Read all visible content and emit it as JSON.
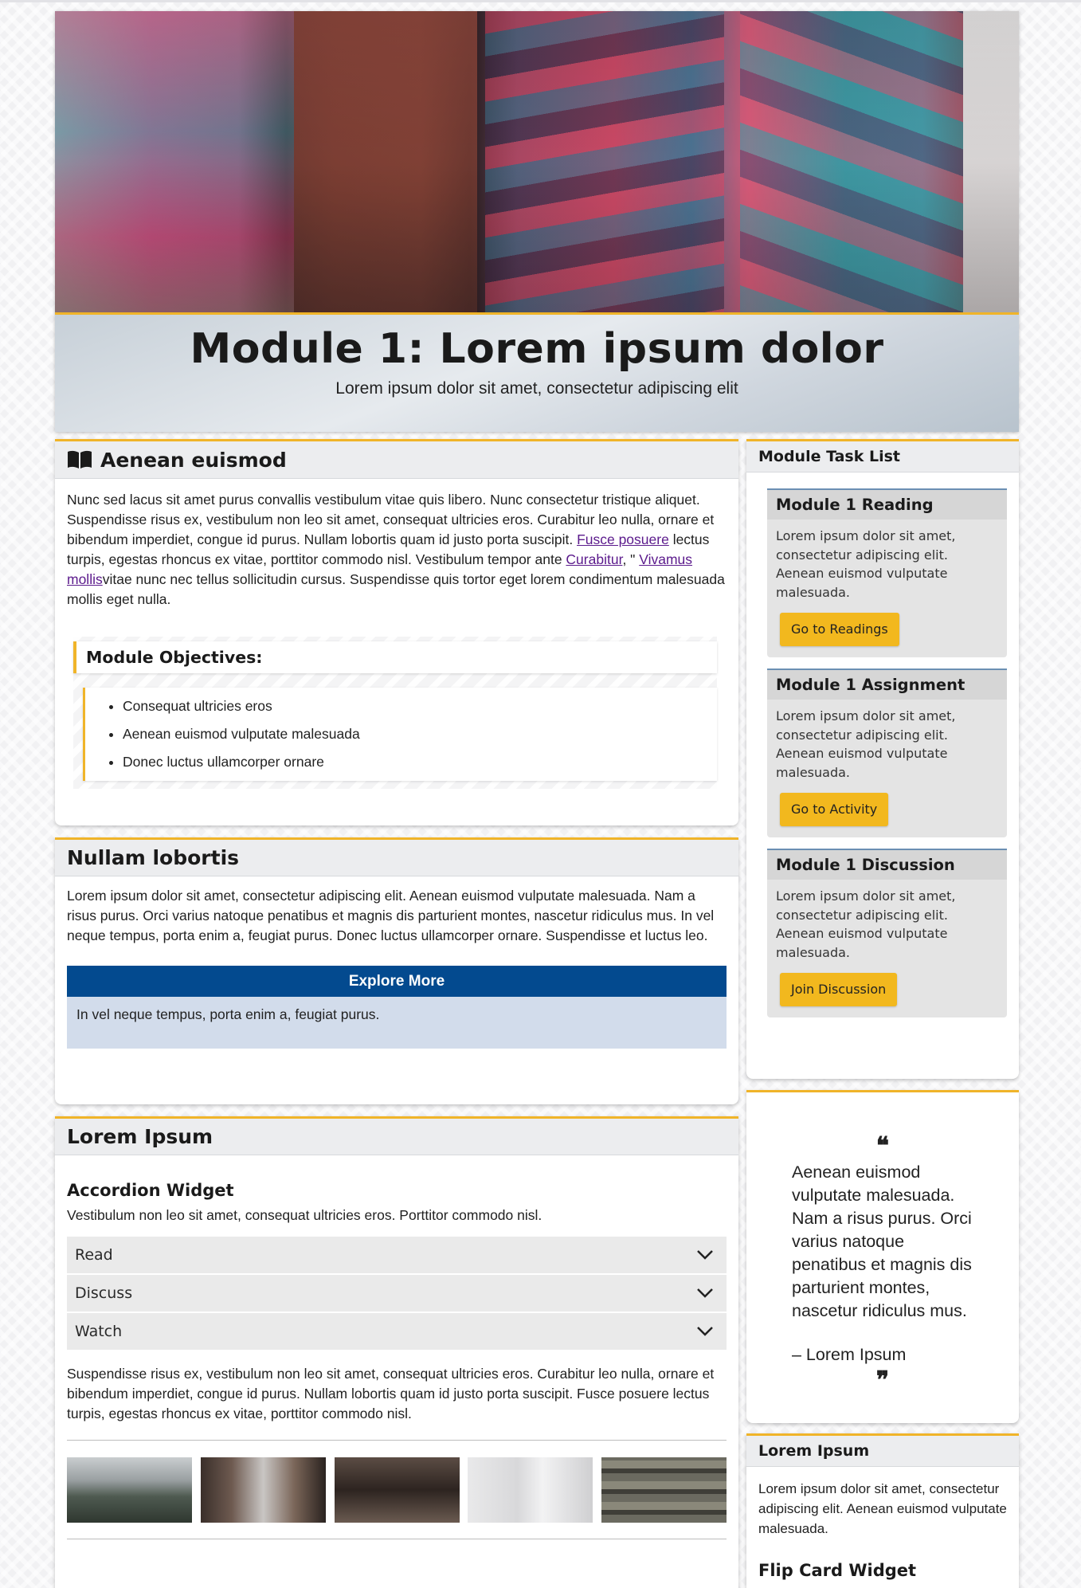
{
  "hero": {
    "title": "Module 1: Lorem ipsum dolor",
    "subtitle": "Lorem ipsum dolor sit amet, consectetur adipiscing elit"
  },
  "section1": {
    "title": "Aenean euismod",
    "icon": "book-icon",
    "p_a": "Nunc sed lacus sit amet purus convallis vestibulum vitae quis libero. Nunc consectetur tristique aliquet. Suspendisse risus ex, vestibulum non leo sit amet, consequat ultricies eros. Curabitur leo nulla, ornare et bibendum imperdiet, congue id purus. Nullam lobortis quam id justo porta suscipit. ",
    "link1": "Fusce posuere",
    "p_b": " lectus turpis, egestas rhoncus ex vitae, porttitor commodo nisl. Vestibulum tempor ante ",
    "link2": "Curabitur",
    "p_c": ", \" ",
    "link3": "Vivamus mollis",
    "p_d": "vitae nunc nec tellus sollicitudin cursus. Suspendisse quis tortor eget lorem condimentum malesuada mollis eget nulla.",
    "objectives_title": "Module Objectives:",
    "objectives": [
      "Consequat ultricies eros",
      "Aenean euismod vulputate malesuada",
      "Donec luctus ullamcorper ornare"
    ]
  },
  "section2": {
    "title": "Nullam lobortis",
    "text": "Lorem ipsum dolor sit amet, consectetur adipiscing elit. Aenean euismod vulputate malesuada. Nam a risus purus. Orci varius natoque penatibus et magnis dis parturient montes, nascetur ridiculus mus. In vel neque tempus, porta enim a, feugiat purus. Donec luctus ullamcorper ornare. Suspendisse et luctus leo.",
    "explore_title": "Explore More",
    "explore_text": "In vel neque tempus, porta enim a, feugiat purus."
  },
  "section3": {
    "title": "Lorem Ipsum",
    "accordion_title": "Accordion Widget",
    "accordion_intro": "Vestibulum non leo sit amet, consequat ultricies eros. Porttitor commodo nisl.",
    "accordion_items": [
      "Read",
      "Discuss",
      "Watch"
    ],
    "after_text": "Suspendisse risus ex, vestibulum non leo sit amet, consequat ultricies eros. Curabitur leo nulla, ornare et bibendum imperdiet, congue id purus. Nullam lobortis quam id justo porta suscipit. Fusce posuere lectus turpis, egestas rhoncus ex vitae, porttitor commodo nisl."
  },
  "tasks": {
    "title": "Module Task List",
    "items": [
      {
        "title": "Module 1 Reading",
        "text": "Lorem ipsum dolor sit amet, consectetur adipiscing elit. Aenean euismod vulputate malesuada.",
        "button": "Go to Readings"
      },
      {
        "title": "Module 1 Assignment",
        "text": "Lorem ipsum dolor sit amet, consectetur adipiscing elit. Aenean euismod vulputate malesuada.",
        "button": "Go to Activity"
      },
      {
        "title": "Module 1 Discussion",
        "text": "Lorem ipsum dolor sit amet, consectetur adipiscing elit. Aenean euismod vulputate malesuada.",
        "button": "Join Discussion"
      }
    ]
  },
  "quote": {
    "open": "❝",
    "text": "Aenean euismod vulputate malesuada. Nam a risus purus. Orci varius natoque penatibus et magnis dis parturient montes, nascetur ridiculus mus.",
    "attribution": "– Lorem Ipsum",
    "close": "❞"
  },
  "side_info": {
    "title": "Lorem Ipsum",
    "text": "Lorem ipsum dolor sit amet, consectetur adipiscing elit. Aenean euismod vulputate malesuada.",
    "flip_title": "Flip Card Widget"
  },
  "colors": {
    "accent": "#f0b429",
    "explore_blue": "#034a8f",
    "button_yellow": "#f2b81e",
    "link_purple": "#5b1a8c"
  }
}
